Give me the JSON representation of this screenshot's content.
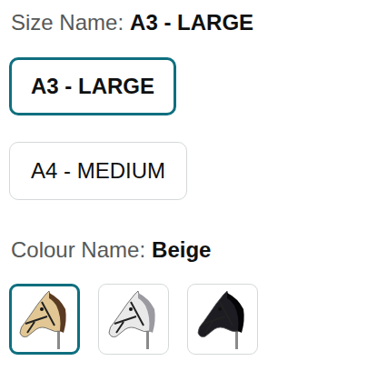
{
  "size": {
    "label": "Size Name:",
    "value": "A3 - LARGE",
    "options": [
      {
        "label": "A3 - LARGE",
        "selected": true
      },
      {
        "label": "A4 - MEDIUM",
        "selected": false
      }
    ]
  },
  "colour": {
    "label": "Colour Name:",
    "value": "Beige",
    "swatches": [
      {
        "selected": true,
        "color": "#e2c795"
      },
      {
        "selected": false,
        "color": "#e9e9ea"
      },
      {
        "selected": false,
        "color": "#1c1c22"
      }
    ]
  }
}
